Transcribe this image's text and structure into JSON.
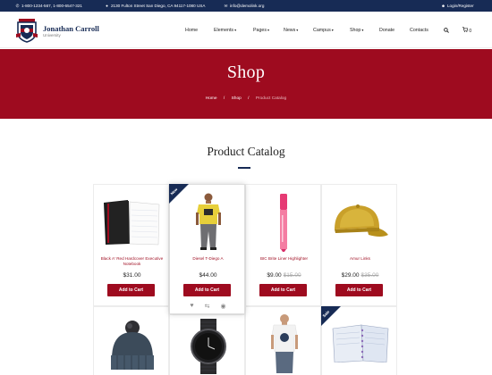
{
  "topbar": {
    "phone": "1-800-1234-567, 1-800-6547-321",
    "address": "2130 Fulton Street San Diego, CA 94117-1080 USA",
    "email": "info@demolink.org",
    "login": "Login/Register"
  },
  "brand": {
    "name": "Jonathan Carroll",
    "sub": "University"
  },
  "nav": [
    {
      "label": "Home",
      "caret": false
    },
    {
      "label": "Elements",
      "caret": true
    },
    {
      "label": "Pages",
      "caret": true
    },
    {
      "label": "News",
      "caret": true
    },
    {
      "label": "Campus",
      "caret": true
    },
    {
      "label": "Shop",
      "caret": true
    },
    {
      "label": "Donate",
      "caret": false
    },
    {
      "label": "Contacts",
      "caret": false
    }
  ],
  "header_icons": {
    "search": "search-icon",
    "cart": "cart-icon",
    "cart_count": "0"
  },
  "banner": {
    "title": "Shop",
    "breadcrumbs": [
      "Home",
      "/",
      "Shop",
      "/",
      "Product Catalog"
    ]
  },
  "section": {
    "title": "Product Catalog"
  },
  "products": [
    {
      "name": "Black A' Red Hardcover Executive Notebook",
      "price": "$31.00",
      "old_price": "",
      "button": "Add to Cart",
      "badge": ""
    },
    {
      "name": "Diesel T-Diego A",
      "price": "$44.00",
      "old_price": "",
      "button": "Add to Cart",
      "badge": "New"
    },
    {
      "name": "BIC Brite Liner Highlighter",
      "price": "$9.00",
      "old_price": "$15.00",
      "button": "Add to Cart",
      "badge": ""
    },
    {
      "name": "Amur Links",
      "price": "$29.00",
      "old_price": "$35.00",
      "button": "Add to Cart",
      "badge": ""
    }
  ],
  "row2_badges": [
    "",
    "",
    "",
    "Sale"
  ],
  "colors": {
    "navy": "#172b55",
    "crimson": "#9e0b1f"
  }
}
